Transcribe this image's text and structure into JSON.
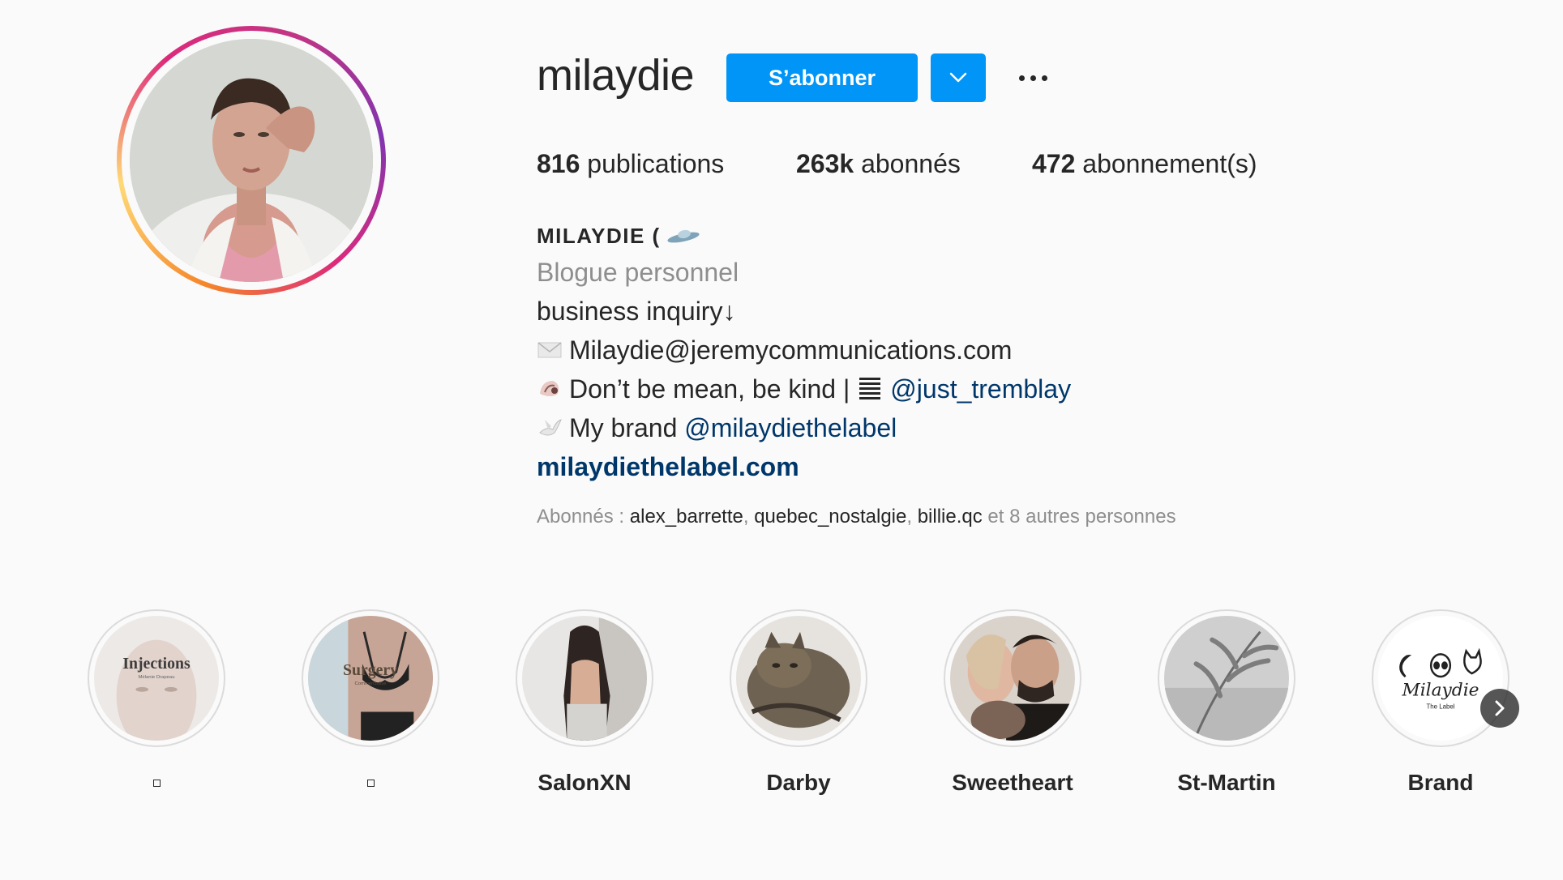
{
  "profile": {
    "username": "milaydie",
    "follow_label": "S’abonner",
    "dropdown_icon": "chevron-down-icon",
    "more_icon": "more-horizontal-icon",
    "accent_color": "#0095f6"
  },
  "stats": {
    "posts_count": "816",
    "posts_label": "publications",
    "followers_count": "263k",
    "followers_label": "abonnés",
    "following_count": "472",
    "following_label": "abonnement(s)"
  },
  "bio": {
    "name": "MILAYDIE (",
    "name_emoji": "flying-saucer-icon",
    "category": "Blogue personnel",
    "line1": "business inquiry↓",
    "line2_emoji": "envelope-icon",
    "line2": "Milaydie@jeremycommunications.com",
    "line3_emoji": "shell-icon",
    "line3_text": "Don’t be mean, be kind |",
    "line3_emoji2": "barcode-icon",
    "line3_mention": "@just_tremblay",
    "line4_emoji": "dove-icon",
    "line4_text": "My brand",
    "line4_mention": "@milaydiethelabel",
    "website": "milaydiethelabel.com"
  },
  "followed_by": {
    "prefix": "Abonnés :",
    "accounts": [
      "alex_barrette",
      "quebec_nostalgie",
      "billie.qc"
    ],
    "suffix": "et 8 autres personnes"
  },
  "highlights": [
    {
      "label": "",
      "cover_text": "Injections",
      "cover_subtext": "Mélanie Drapeau"
    },
    {
      "label": "",
      "cover_text": "Surgery",
      "cover_subtext": "Commercialisé"
    },
    {
      "label": "SalonXN"
    },
    {
      "label": "Darby"
    },
    {
      "label": "Sweetheart"
    },
    {
      "label": "St-Martin"
    },
    {
      "label": "Brand",
      "cover_text": "Milaydie",
      "cover_subtext": "The Label"
    }
  ],
  "highlights_next_icon": "chevron-right-icon"
}
